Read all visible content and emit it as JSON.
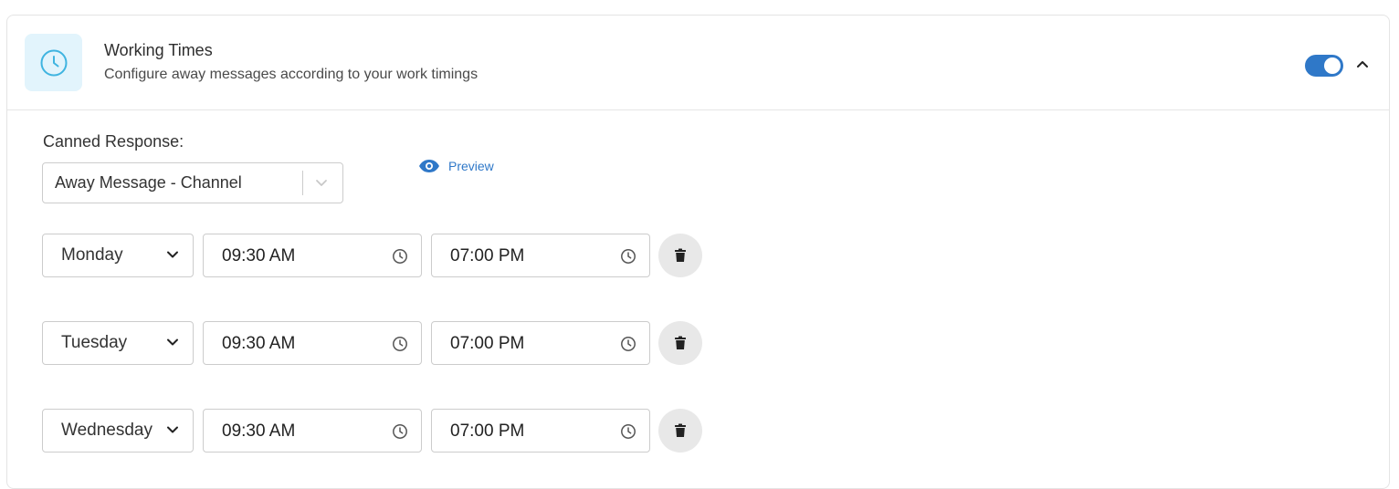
{
  "header": {
    "title": "Working Times",
    "subtitle": "Configure away messages according to your work timings",
    "icon": "clock-icon",
    "toggle_on": true,
    "accent_color": "#2f78c8",
    "icon_bg_color": "#e2f4fc"
  },
  "canned": {
    "label": "Canned Response:",
    "selected": "Away Message - Channel",
    "preview_label": "Preview"
  },
  "schedule": [
    {
      "day": "Monday",
      "start": "09:30 AM",
      "end": "07:00 PM"
    },
    {
      "day": "Tuesday",
      "start": "09:30 AM",
      "end": "07:00 PM"
    },
    {
      "day": "Wednesday",
      "start": "09:30 AM",
      "end": "07:00 PM"
    }
  ]
}
